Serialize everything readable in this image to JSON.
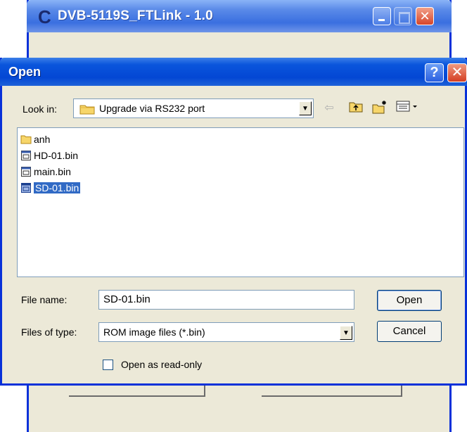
{
  "main_window": {
    "title": "DVB-5119S_FTLink - 1.0",
    "icon": "app-c-icon"
  },
  "dialog": {
    "title": "Open",
    "help_glyph": "?",
    "close_glyph": "✕",
    "look_in": {
      "label": "Look in:",
      "value": "Upgrade via RS232 port"
    },
    "toolbar": {
      "back_icon": "back-arrow-icon",
      "up_icon": "up-one-level-icon",
      "new_folder_icon": "new-folder-icon",
      "views_icon": "views-menu-icon"
    },
    "files": [
      {
        "name": "anh",
        "type": "folder",
        "selected": false
      },
      {
        "name": "HD-01.bin",
        "type": "file",
        "selected": false
      },
      {
        "name": "main.bin",
        "type": "file",
        "selected": false
      },
      {
        "name": "SD-01.bin",
        "type": "file",
        "selected": true
      }
    ],
    "file_name": {
      "label": "File name:",
      "value": "SD-01.bin"
    },
    "file_type": {
      "label": "Files of type:",
      "value": "ROM image files (*.bin)"
    },
    "buttons": {
      "open": "Open",
      "cancel": "Cancel"
    },
    "readonly": {
      "label": "Open as read-only",
      "checked": false
    }
  },
  "colors": {
    "titlebar_blue": "#0347d4",
    "selection": "#316ac5",
    "dialog_bg": "#ece9d8",
    "close_red": "#d43e22"
  }
}
